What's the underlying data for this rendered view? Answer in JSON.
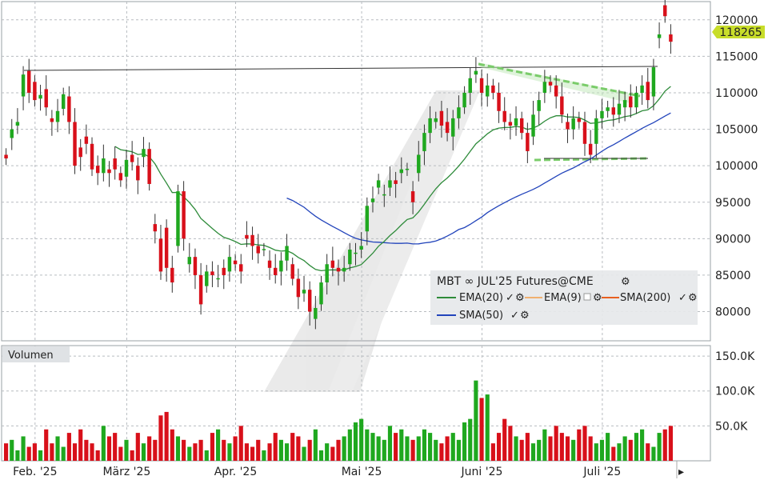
{
  "chart_data": {
    "type": "candlestick",
    "instrument_title": "MBT ∞ JUL'25 Futures@CME",
    "last_price_label": "118265",
    "price_axis": {
      "ylim": [
        76000,
        122500
      ],
      "ticks": [
        "120000",
        "115000",
        "110000",
        "105000",
        "100000",
        "95000",
        "90000",
        "85000",
        "80000"
      ]
    },
    "x_tick_labels": [
      "Feb. '25",
      "März '25",
      "Apr. '25",
      "Mai '25",
      "Juni '25",
      "Juli '25"
    ],
    "legend": {
      "items": [
        {
          "name": "EMA(20)",
          "color": "#2e8b3a"
        },
        {
          "name": "EMA(9)",
          "color": "#f0b070"
        },
        {
          "name": "SMA(200)",
          "color": "#e86020"
        },
        {
          "name": "SMA(50)",
          "color": "#2244bb"
        }
      ]
    },
    "volume_panel": {
      "title": "Volumen",
      "ticks": [
        "150.0K",
        "100.0K",
        "50.0K"
      ],
      "ylim": [
        0,
        165000
      ]
    },
    "colors": {
      "up": "#1fa81f",
      "down": "#d8101a",
      "ema20": "#2e8b3a",
      "sma50": "#2244bb",
      "trend_green": "#7acc6a",
      "last_price_bg": "#c8dd2a"
    },
    "candles": [
      [
        101500,
        101000
      ],
      [
        103800,
        105000
      ],
      [
        105500,
        106000
      ],
      [
        109500,
        112500
      ],
      [
        113000,
        110000
      ],
      [
        111500,
        109000
      ],
      [
        109200,
        109700
      ],
      [
        110500,
        108000
      ],
      [
        106500,
        106000
      ],
      [
        106000,
        107500
      ],
      [
        107800,
        109800
      ],
      [
        109500,
        106000
      ],
      [
        106000,
        100000
      ],
      [
        102500,
        101200
      ],
      [
        104000,
        103000
      ],
      [
        103000,
        99500
      ],
      [
        100000,
        99000
      ],
      [
        99000,
        101000
      ],
      [
        99500,
        99000
      ],
      [
        101000,
        99500
      ],
      [
        99000,
        98000
      ],
      [
        98500,
        100800
      ],
      [
        101500,
        100500
      ],
      [
        100000,
        98000
      ],
      [
        101200,
        102300
      ],
      [
        102300,
        97500
      ],
      [
        92000,
        91000
      ],
      [
        90000,
        85500
      ],
      [
        91500,
        86000
      ],
      [
        86000,
        84000
      ],
      [
        89000,
        96500
      ],
      [
        96500,
        90000
      ],
      [
        86500,
        87500
      ],
      [
        87500,
        85000
      ],
      [
        85000,
        81000
      ],
      [
        83500,
        85500
      ],
      [
        85500,
        85000
      ],
      [
        84500,
        84500
      ],
      [
        86000,
        85000
      ],
      [
        85500,
        87500
      ],
      [
        87000,
        86500
      ],
      [
        86500,
        85500
      ],
      [
        90500,
        90000
      ],
      [
        90500,
        89000
      ],
      [
        89000,
        88000
      ],
      [
        88500,
        88500
      ],
      [
        87000,
        86000
      ],
      [
        86000,
        85000
      ],
      [
        85500,
        87000
      ],
      [
        87000,
        89000
      ],
      [
        86500,
        84500
      ],
      [
        84500,
        82000
      ],
      [
        82500,
        83000
      ],
      [
        83000,
        80000
      ],
      [
        79000,
        80500
      ],
      [
        81000,
        84000
      ],
      [
        84000,
        86500
      ],
      [
        87000,
        86000
      ],
      [
        86000,
        85500
      ],
      [
        85500,
        86000
      ],
      [
        86500,
        88500
      ],
      [
        88000,
        88000
      ],
      [
        88500,
        89000
      ],
      [
        91000,
        94500
      ],
      [
        95000,
        95500
      ],
      [
        97000,
        98000
      ],
      [
        96000,
        96000
      ],
      [
        97000,
        98000
      ],
      [
        98000,
        97500
      ],
      [
        99000,
        99500
      ],
      [
        99500,
        99500
      ],
      [
        96500,
        95000
      ],
      [
        99000,
        101500
      ],
      [
        102000,
        104500
      ],
      [
        104500,
        106500
      ],
      [
        106000,
        106500
      ],
      [
        107500,
        105500
      ],
      [
        106000,
        104500
      ],
      [
        104000,
        106500
      ],
      [
        106500,
        108000
      ],
      [
        108000,
        110000
      ],
      [
        110000,
        112000
      ],
      [
        112500,
        113000
      ],
      [
        112000,
        110000
      ],
      [
        109500,
        111000
      ],
      [
        111000,
        110000
      ],
      [
        110000,
        107500
      ],
      [
        107500,
        106000
      ],
      [
        106000,
        105500
      ],
      [
        105500,
        106500
      ],
      [
        106500,
        104500
      ],
      [
        104500,
        102000
      ],
      [
        104000,
        107000
      ],
      [
        107500,
        109000
      ],
      [
        110000,
        111500
      ],
      [
        111500,
        111000
      ],
      [
        111000,
        109500
      ],
      [
        109500,
        107000
      ],
      [
        106000,
        105000
      ],
      [
        105000,
        106500
      ],
      [
        106500,
        106000
      ],
      [
        106000,
        103000
      ],
      [
        103000,
        101500
      ],
      [
        103000,
        106500
      ],
      [
        106500,
        107500
      ],
      [
        107500,
        108000
      ],
      [
        108000,
        107000
      ],
      [
        107000,
        108500
      ],
      [
        108000,
        109000
      ],
      [
        109500,
        108000
      ],
      [
        108000,
        110000
      ],
      [
        110000,
        111000
      ],
      [
        111500,
        109000
      ],
      [
        109500,
        113500
      ],
      [
        117500,
        118000
      ],
      [
        122000,
        120500
      ],
      [
        118000,
        117000
      ]
    ],
    "volumes": [
      25000,
      30000,
      15000,
      35000,
      20000,
      25000,
      15000,
      45000,
      25000,
      35000,
      20000,
      40000,
      25000,
      45000,
      30000,
      25000,
      15000,
      50000,
      35000,
      40000,
      20000,
      30000,
      15000,
      40000,
      25000,
      35000,
      30000,
      65000,
      70000,
      45000,
      35000,
      30000,
      20000,
      25000,
      30000,
      15000,
      40000,
      45000,
      30000,
      25000,
      35000,
      50000,
      25000,
      20000,
      30000,
      15000,
      25000,
      40000,
      30000,
      25000,
      40000,
      35000,
      20000,
      30000,
      45000,
      15000,
      25000,
      20000,
      30000,
      35000,
      45000,
      55000,
      60000,
      45000,
      40000,
      35000,
      30000,
      50000,
      40000,
      45000,
      35000,
      30000,
      35000,
      45000,
      40000,
      30000,
      25000,
      35000,
      40000,
      30000,
      55000,
      60000,
      115000,
      90000,
      95000,
      25000,
      40000,
      60000,
      50000,
      35000,
      30000,
      40000,
      25000,
      30000,
      45000,
      35000,
      50000,
      40000,
      35000,
      30000,
      45000,
      50000,
      35000,
      25000,
      30000,
      40000,
      20000,
      25000,
      35000,
      30000,
      40000,
      45000,
      25000,
      20000,
      40000,
      45000,
      50000
    ]
  }
}
